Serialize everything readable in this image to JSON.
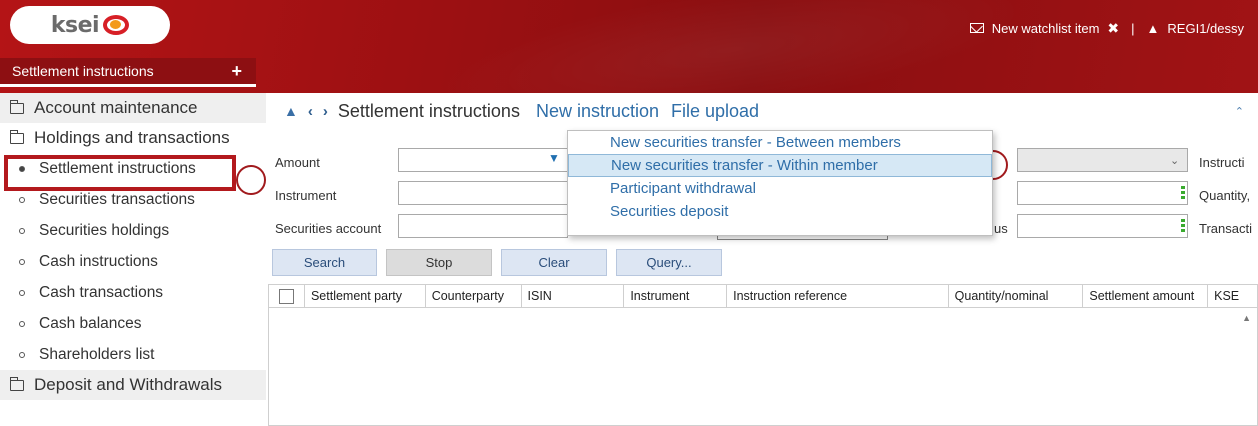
{
  "header": {
    "logo_text": "ksei",
    "watchlist_label": "New watchlist item",
    "close_glyph": "✖",
    "separator": "|",
    "user": "REGI1/dessy",
    "brand_color": "#a11315"
  },
  "tabs": [
    {
      "label": "Settlement instructions",
      "add_glyph": "+"
    }
  ],
  "sidebar": {
    "groups": [
      {
        "label": "Account maintenance"
      },
      {
        "label": "Holdings and transactions"
      },
      {
        "label": "Deposit and Withdrawals"
      }
    ],
    "items": [
      {
        "label": "Settlement instructions"
      },
      {
        "label": "Securities transactions"
      },
      {
        "label": "Securities holdings"
      },
      {
        "label": "Cash instructions"
      },
      {
        "label": "Cash transactions"
      },
      {
        "label": "Cash balances"
      },
      {
        "label": "Shareholders list"
      }
    ]
  },
  "main": {
    "title": "Settlement instructions",
    "new_instruction": "New instruction",
    "file_upload": "File upload",
    "labels": {
      "amount": "Amount",
      "instrument": "Instrument",
      "securities_account": "Securities account",
      "instruction_partial": "Instructi",
      "quantity_partial": "Quantity,",
      "transaction_partial": "Transacti",
      "status_partial": "us"
    },
    "buttons": {
      "search": "Search",
      "stop": "Stop",
      "clear": "Clear",
      "query": "Query..."
    },
    "columns": [
      "Settlement party",
      "Counterparty",
      "ISIN",
      "Instrument",
      "Instruction reference",
      "Quantity/nominal",
      "Settlement amount",
      "KSE"
    ]
  },
  "menu": {
    "items": [
      {
        "label": "New securities transfer - Between members"
      },
      {
        "label": "New securities transfer - Within member"
      },
      {
        "label": "Participant withdrawal"
      },
      {
        "label": "Securities deposit"
      }
    ]
  }
}
